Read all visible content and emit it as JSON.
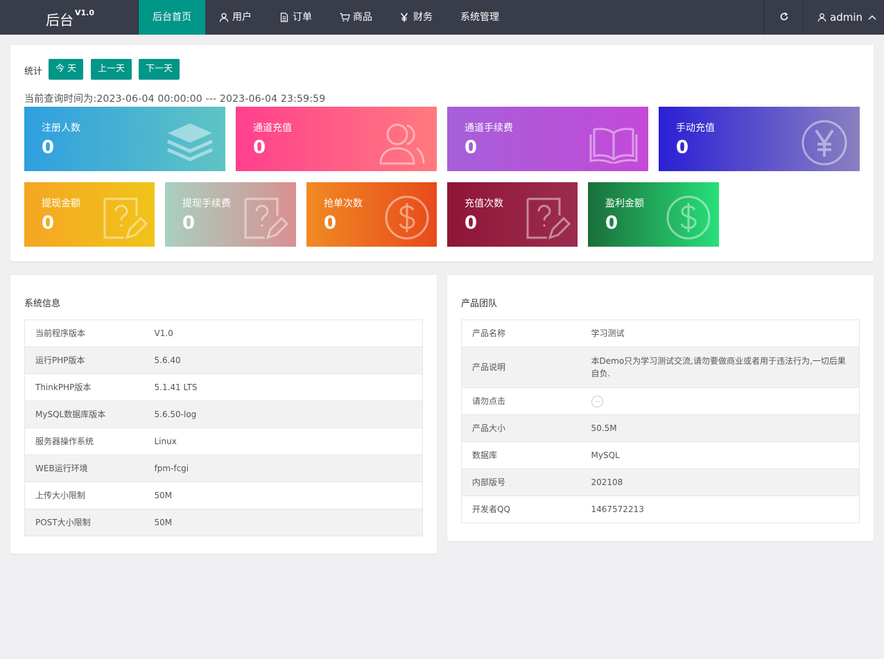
{
  "header": {
    "logo_text": "后台",
    "logo_version": "V1.0",
    "nav": [
      {
        "label": "后台首页",
        "icon": "",
        "active": true
      },
      {
        "label": "用户",
        "icon": "user-icon",
        "active": false
      },
      {
        "label": "订单",
        "icon": "document-icon",
        "active": false
      },
      {
        "label": "商品",
        "icon": "cart-icon",
        "active": false
      },
      {
        "label": "财务",
        "icon": "yen-icon",
        "active": false
      },
      {
        "label": "系统管理",
        "icon": "",
        "active": false
      }
    ],
    "refresh_icon": "refresh-icon",
    "user_name": "admin"
  },
  "stats": {
    "label": "统计",
    "buttons": {
      "today": "今 天",
      "prev": "上一天",
      "next": "下一天"
    },
    "range_text": "当前查询时间为:2023-06-04 00:00:00 --- 2023-06-04 23:59:59",
    "tiles": [
      {
        "label": "注册人数",
        "value": "0",
        "icon": "layers-icon"
      },
      {
        "label": "通道充值",
        "value": "0",
        "icon": "users-icon"
      },
      {
        "label": "通道手续费",
        "value": "0",
        "icon": "book-icon"
      },
      {
        "label": "手动充值",
        "value": "0",
        "icon": "yen-circle-icon"
      },
      {
        "label": "提现金额",
        "value": "0",
        "icon": "question-edit-icon"
      },
      {
        "label": "提现手续费",
        "value": "0",
        "icon": "question-edit-icon"
      },
      {
        "label": "抢单次数",
        "value": "0",
        "icon": "dollar-circle-icon"
      },
      {
        "label": "充值次数",
        "value": "0",
        "icon": "question-edit-icon"
      },
      {
        "label": "盈利金额",
        "value": "0",
        "icon": "dollar-circle-icon"
      }
    ]
  },
  "system_info": {
    "title": "系统信息",
    "rows": [
      {
        "key": "当前程序版本",
        "value": "V1.0"
      },
      {
        "key": "运行PHP版本",
        "value": "5.6.40"
      },
      {
        "key": "ThinkPHP版本",
        "value": "5.1.41 LTS"
      },
      {
        "key": "MySQL数据库版本",
        "value": "5.6.50-log"
      },
      {
        "key": "服务器操作系统",
        "value": "Linux"
      },
      {
        "key": "WEB运行环境",
        "value": "fpm-fcgi"
      },
      {
        "key": "上传大小限制",
        "value": "50M"
      },
      {
        "key": "POST大小限制",
        "value": "50M"
      }
    ]
  },
  "product_team": {
    "title": "产品团队",
    "rows": [
      {
        "key": "产品名称",
        "value": "学习测试"
      },
      {
        "key": "产品说明",
        "value": "本Demo只为学习测试交流,请勿要做商业或者用于违法行为,一切后果自负."
      },
      {
        "key": "请勿点击",
        "value": ""
      },
      {
        "key": "产品大小",
        "value": "50.5M"
      },
      {
        "key": "数据库",
        "value": "MySQL"
      },
      {
        "key": "内部版号",
        "value": "202108"
      },
      {
        "key": "开发者QQ",
        "value": "1467572213"
      }
    ]
  },
  "colors": {
    "topbar": "#393d49",
    "accent": "#009688",
    "background": "#f0eff1"
  }
}
